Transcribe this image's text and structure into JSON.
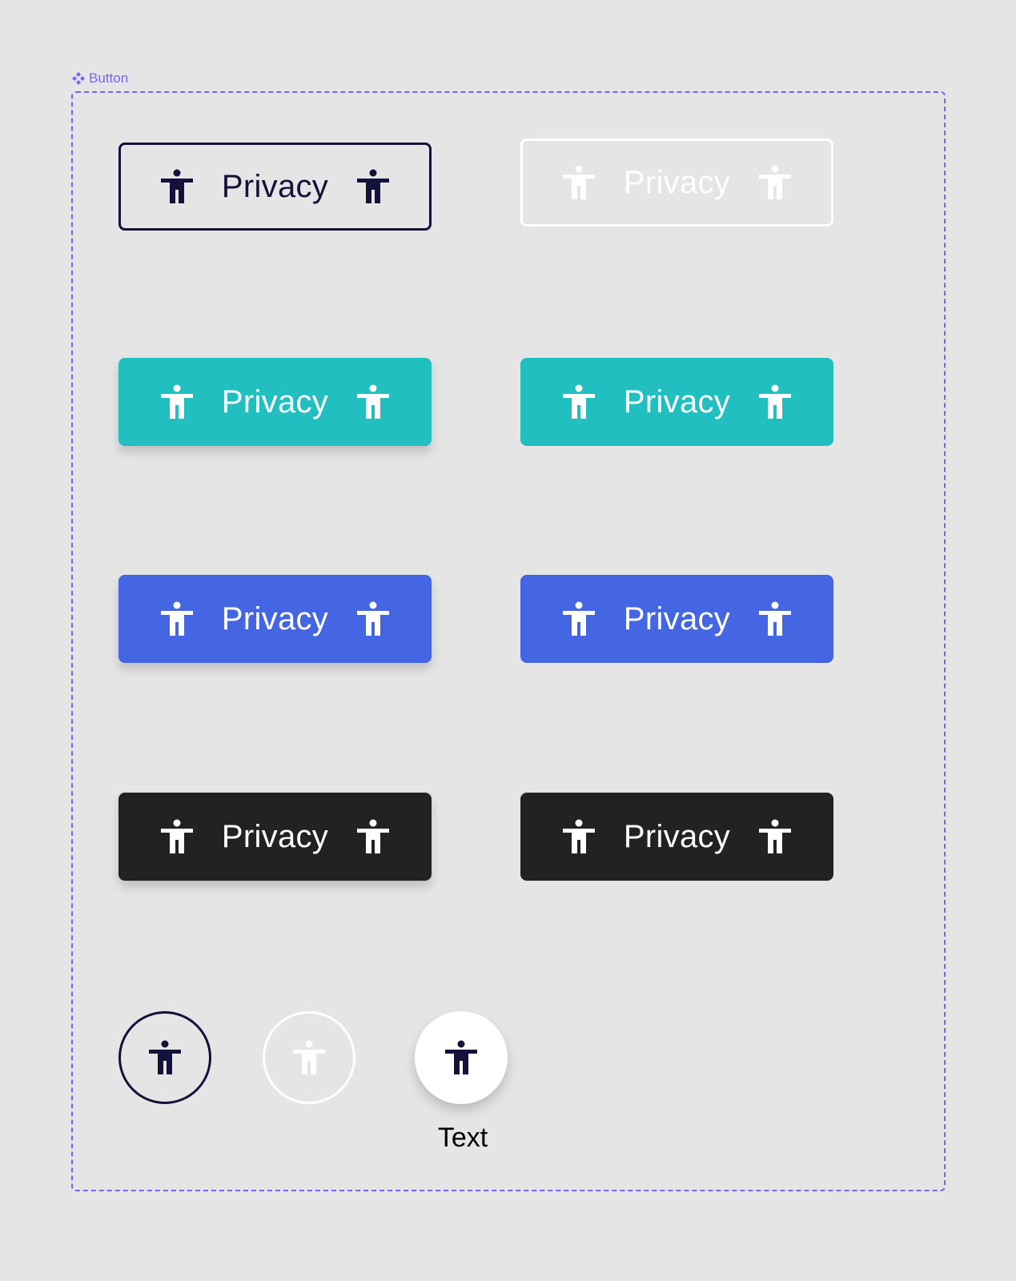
{
  "frame": {
    "label": "Button",
    "border_color": "#7b61ff"
  },
  "colors": {
    "dark": "#14123a",
    "white": "#ffffff",
    "teal": "#22bfc0",
    "blue": "#4466e3",
    "black": "#222222"
  },
  "icons": {
    "button_icon": "accessibility-person-icon",
    "frame_icon": "component-icon"
  },
  "buttons": [
    {
      "variant": "outline-dark",
      "label": "Privacy"
    },
    {
      "variant": "outline-light",
      "label": "Privacy"
    },
    {
      "variant": "teal-elevated",
      "label": "Privacy"
    },
    {
      "variant": "teal-flat",
      "label": "Privacy"
    },
    {
      "variant": "blue-elevated",
      "label": "Privacy"
    },
    {
      "variant": "blue-flat",
      "label": "Privacy"
    },
    {
      "variant": "black-elevated",
      "label": "Privacy"
    },
    {
      "variant": "black-flat",
      "label": "Privacy"
    }
  ],
  "icon_buttons": [
    {
      "variant": "outline-dark"
    },
    {
      "variant": "outline-light"
    },
    {
      "variant": "white-elevated",
      "caption": "Text"
    }
  ]
}
